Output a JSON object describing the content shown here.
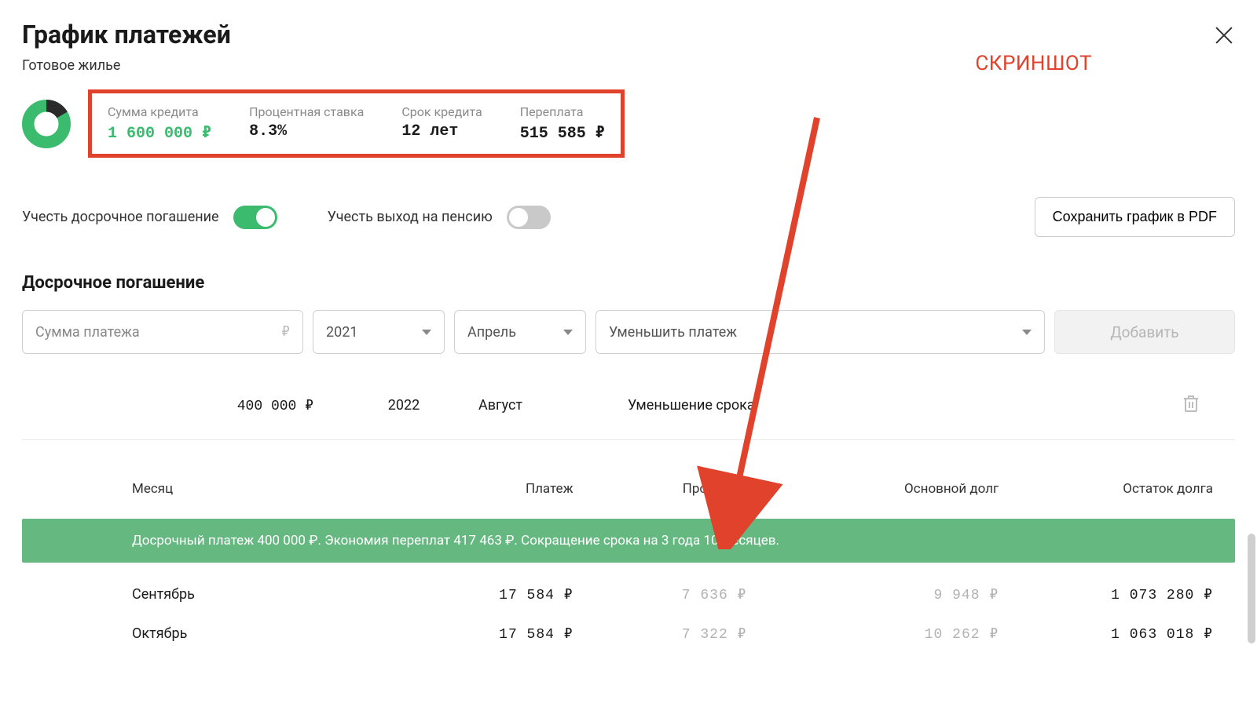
{
  "header": {
    "title": "График платежей",
    "subtitle": "Готовое жилье"
  },
  "overlay": {
    "note": "СКРИНШОТ"
  },
  "summary": {
    "items": [
      {
        "label": "Сумма кредита",
        "value": "1 600 000 ₽",
        "green": true
      },
      {
        "label": "Процентная ставка",
        "value": "8.3%",
        "green": false
      },
      {
        "label": "Срок кредита",
        "value": "12 лет",
        "green": false
      },
      {
        "label": "Переплата",
        "value": "515 585 ₽",
        "green": false
      }
    ]
  },
  "toggles": {
    "early": "Учесть досрочное погашение",
    "pension": "Учесть выход на пенсию",
    "pdf": "Сохранить график в PDF"
  },
  "section_early_title": "Досрочное погашение",
  "form": {
    "amount_placeholder": "Сумма платежа",
    "rub_symbol": "₽",
    "year": "2021",
    "month": "Апрель",
    "mode": "Уменьшить платеж",
    "add": "Добавить"
  },
  "entry": {
    "amount": "400 000 ₽",
    "year": "2022",
    "month": "Август",
    "mode": "Уменьшение срока"
  },
  "table": {
    "headers": {
      "month": "Месяц",
      "payment": "Платеж",
      "interest": "Проценты",
      "principal": "Основной долг",
      "remaining": "Остаток долга"
    },
    "banner": "Досрочный платеж 400 000 ₽. Экономия переплат 417 463 ₽. Сокращение срока на 3 года 10 месяцев.",
    "rows": [
      {
        "month": "Сентябрь",
        "payment": "17 584 ₽",
        "interest": "7 636 ₽",
        "principal": "9 948 ₽",
        "remaining": "1 073 280 ₽"
      },
      {
        "month": "Октябрь",
        "payment": "17 584 ₽",
        "interest": "7 322 ₽",
        "principal": "10 262 ₽",
        "remaining": "1 063 018 ₽"
      }
    ]
  }
}
